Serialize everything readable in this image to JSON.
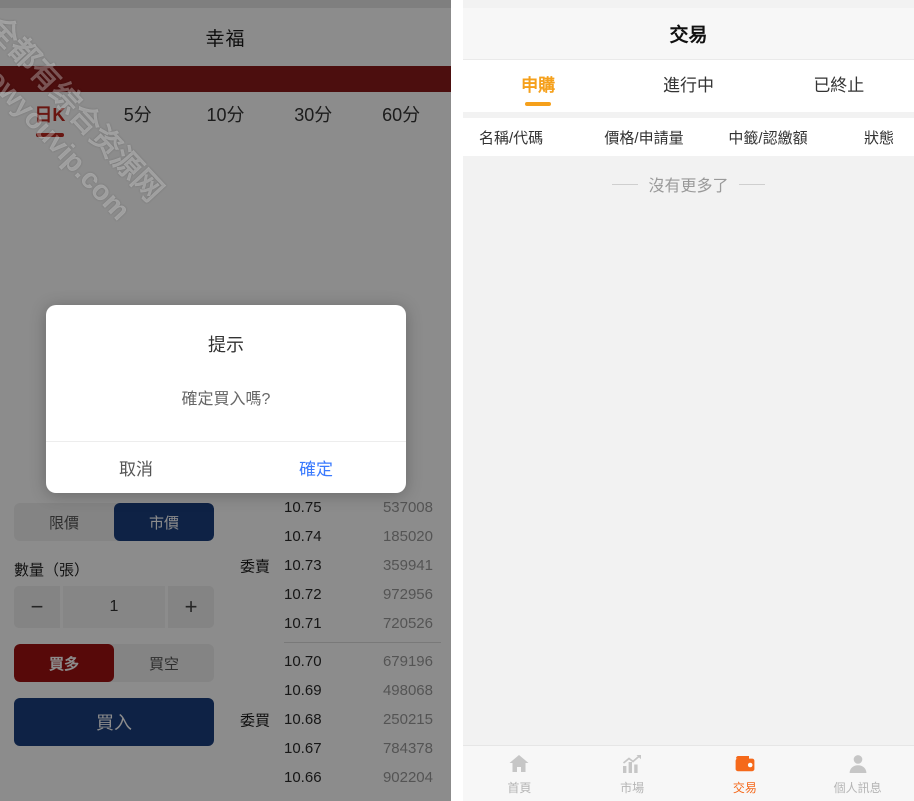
{
  "watermark": {
    "line1": "全都有综合资源网",
    "line2": "dowyouvip.com"
  },
  "left_panel": {
    "header": {
      "title": "幸福"
    },
    "chart_tabs": [
      {
        "label": "日K",
        "active": true
      },
      {
        "label": "5分",
        "active": false
      },
      {
        "label": "10分",
        "active": false
      },
      {
        "label": "30分",
        "active": false
      },
      {
        "label": "60分",
        "active": false
      }
    ],
    "order_entry": {
      "price_type": [
        {
          "label": "限價",
          "selected": false
        },
        {
          "label": "市價",
          "selected": true
        }
      ],
      "quantity_label": "數量（張）",
      "quantity_minus": "−",
      "quantity_value": "1",
      "quantity_plus": "+",
      "direction": [
        {
          "label": "買多",
          "selected": true
        },
        {
          "label": "買空",
          "selected": false
        }
      ],
      "submit_label": "買入"
    },
    "orderbook": {
      "sell_label": "委賣",
      "buy_label": "委買",
      "sell_rows": [
        {
          "price": "10.75",
          "volume": "537008"
        },
        {
          "price": "10.74",
          "volume": "185020"
        },
        {
          "price": "10.73",
          "volume": "359941"
        },
        {
          "price": "10.72",
          "volume": "972956"
        },
        {
          "price": "10.71",
          "volume": "720526"
        }
      ],
      "buy_rows": [
        {
          "price": "10.70",
          "volume": "679196"
        },
        {
          "price": "10.69",
          "volume": "498068"
        },
        {
          "price": "10.68",
          "volume": "250215"
        },
        {
          "price": "10.67",
          "volume": "784378"
        },
        {
          "price": "10.66",
          "volume": "902204"
        }
      ]
    },
    "modal": {
      "title": "提示",
      "message": "確定買入嗎?",
      "cancel_label": "取消",
      "confirm_label": "確定"
    }
  },
  "right_panel": {
    "header": {
      "title": "交易"
    },
    "tabs": [
      {
        "label": "申購",
        "active": true
      },
      {
        "label": "進行中",
        "active": false
      },
      {
        "label": "已終止",
        "active": false
      }
    ],
    "columns": {
      "name_code": "名稱/代碼",
      "price_amount": "價格/申請量",
      "lot_paid": "中籤/認繳額",
      "status": "狀態"
    },
    "empty_state": "沒有更多了",
    "bottom_nav": [
      {
        "label": "首頁",
        "icon": "home-icon",
        "active": false
      },
      {
        "label": "市場",
        "icon": "chart-icon",
        "active": false
      },
      {
        "label": "交易",
        "icon": "wallet-icon",
        "active": true
      },
      {
        "label": "個人訊息",
        "icon": "person-icon",
        "active": false
      }
    ]
  },
  "colors": {
    "brand_red": "#8b1a1a",
    "tab_red": "#c0291f",
    "blue": "#1b3f7e",
    "buy_red": "#9e1111",
    "orange": "#f5a01b",
    "nav_active_orange": "#f5691b",
    "link_blue": "#3a7afe"
  }
}
